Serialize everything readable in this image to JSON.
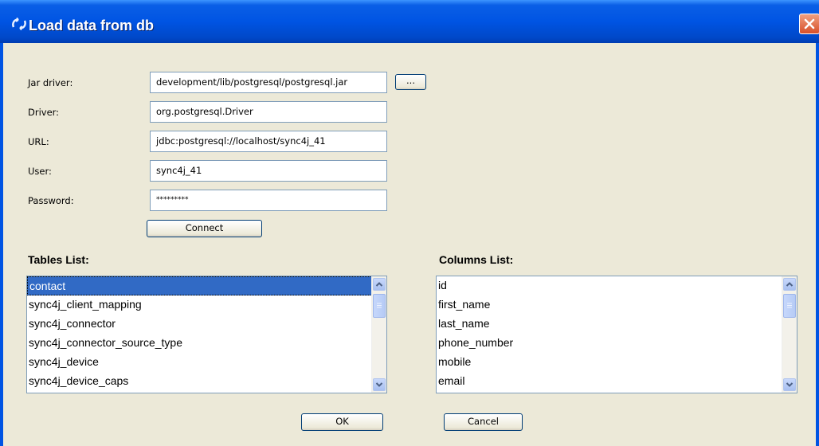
{
  "window": {
    "title": "Load data from db"
  },
  "form": {
    "jar_label": "Jar driver:",
    "jar_value": "development/lib/postgresql/postgresql.jar",
    "browse_label": "...",
    "driver_label": "Driver:",
    "driver_value": "org.postgresql.Driver",
    "url_label": "URL:",
    "url_value": "jdbc:postgresql://localhost/sync4j_41",
    "user_label": "User:",
    "user_value": "sync4j_41",
    "password_label": "Password:",
    "password_value": "*********",
    "connect_label": "Connect"
  },
  "tables": {
    "label": "Tables List:",
    "items": [
      "contact",
      "sync4j_client_mapping",
      "sync4j_connector",
      "sync4j_connector_source_type",
      "sync4j_device",
      "sync4j_device_caps"
    ],
    "selected": "contact"
  },
  "columns": {
    "label": "Columns List:",
    "items": [
      "id",
      "first_name",
      "last_name",
      "phone_number",
      "mobile",
      "email"
    ]
  },
  "footer": {
    "ok_label": "OK",
    "cancel_label": "Cancel"
  },
  "colors": {
    "title_bar": "#0054e3",
    "selection": "#316ac5",
    "close_button": "#d8502a",
    "dialog_bg": "#ece9d8"
  }
}
